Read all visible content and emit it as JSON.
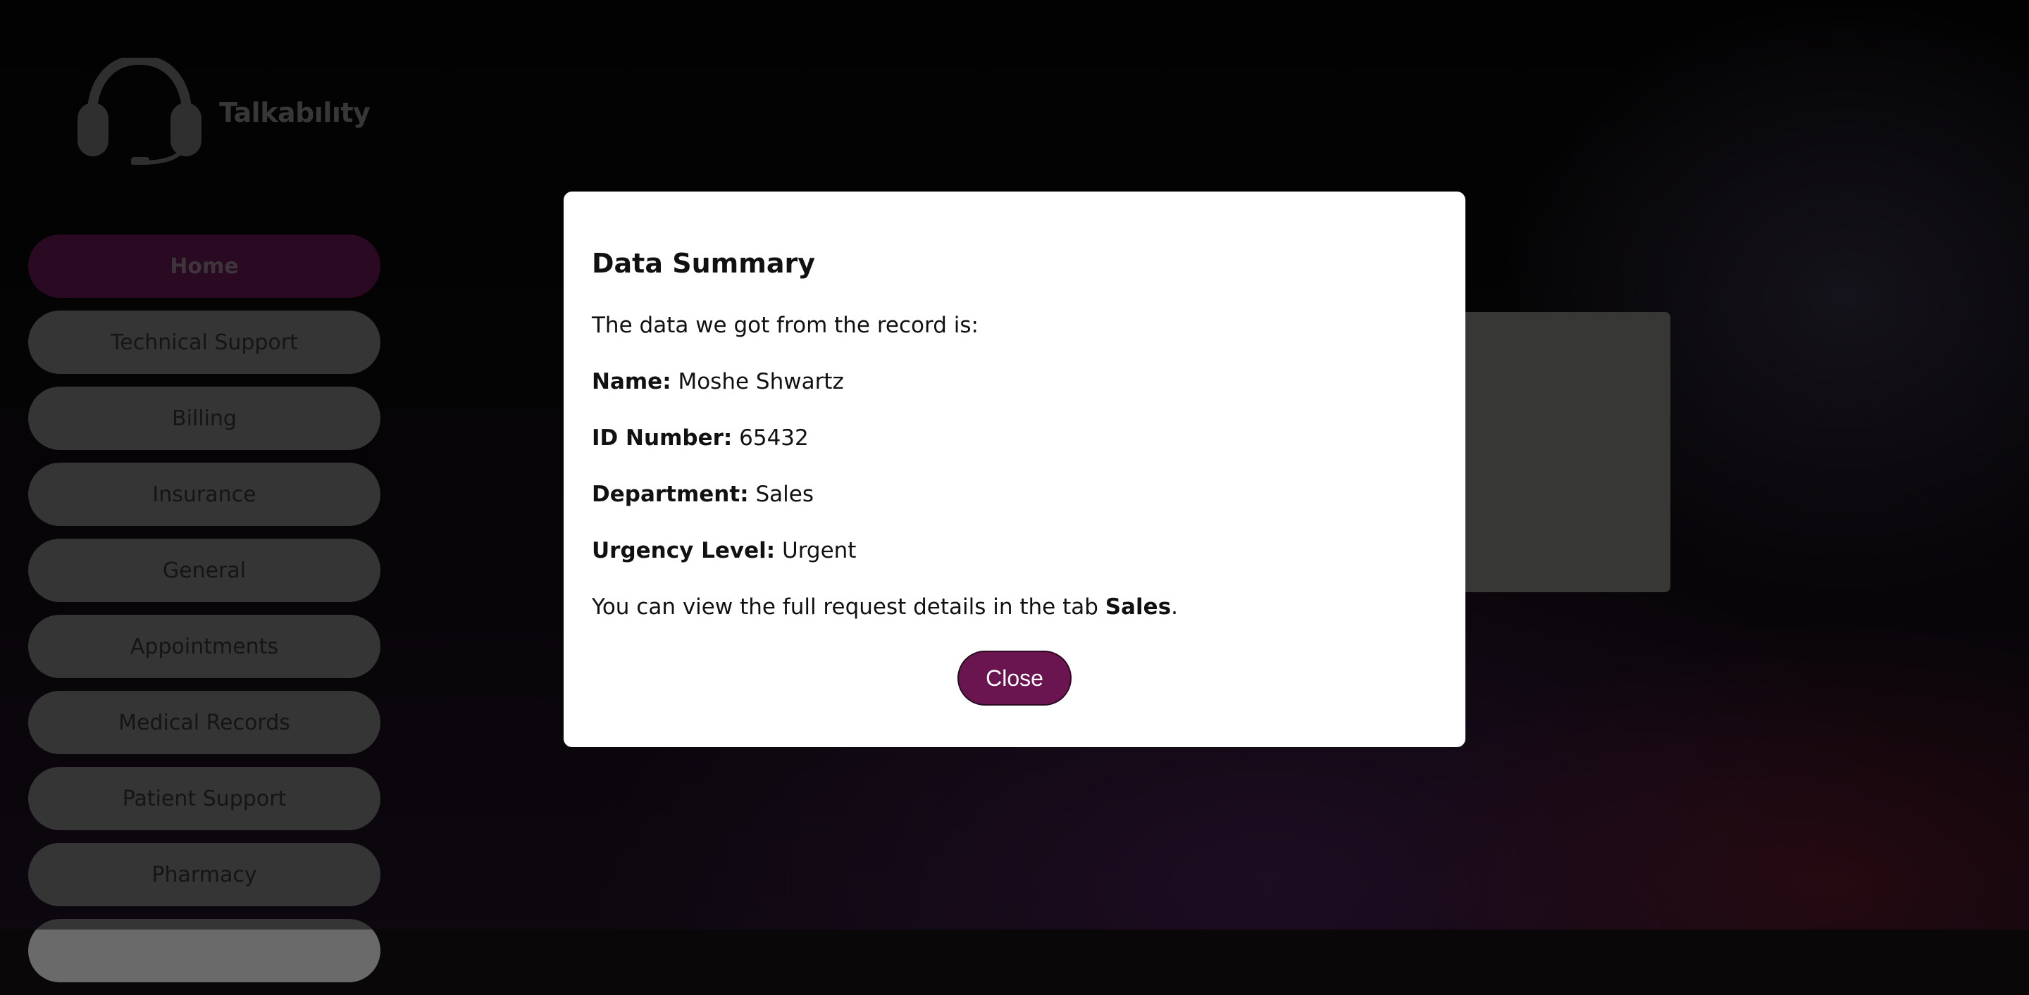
{
  "brand": {
    "name": "Talkabılıty"
  },
  "sidebar": {
    "items": [
      {
        "label": "Home",
        "active": true
      },
      {
        "label": "Technical Support"
      },
      {
        "label": "Billing"
      },
      {
        "label": "Insurance"
      },
      {
        "label": "General"
      },
      {
        "label": "Appointments"
      },
      {
        "label": "Medical Records"
      },
      {
        "label": "Patient Support"
      },
      {
        "label": "Pharmacy"
      }
    ]
  },
  "modal": {
    "title": "Data Summary",
    "intro": "The data we got from the record is:",
    "fields": {
      "name_label": "Name:",
      "name_value": "Moshe Shwartz",
      "id_label": "ID Number:",
      "id_value": "65432",
      "department_label": "Department:",
      "department_value": "Sales",
      "urgency_label": "Urgency Level:",
      "urgency_value": "Urgent"
    },
    "footer_prefix": "You can view the full request details in the tab ",
    "footer_tab": "Sales",
    "footer_suffix": ".",
    "close_label": "Close"
  },
  "colors": {
    "accent": "#6b1550",
    "nav_button": "#6a6a6a",
    "nav_active": "#521445"
  }
}
